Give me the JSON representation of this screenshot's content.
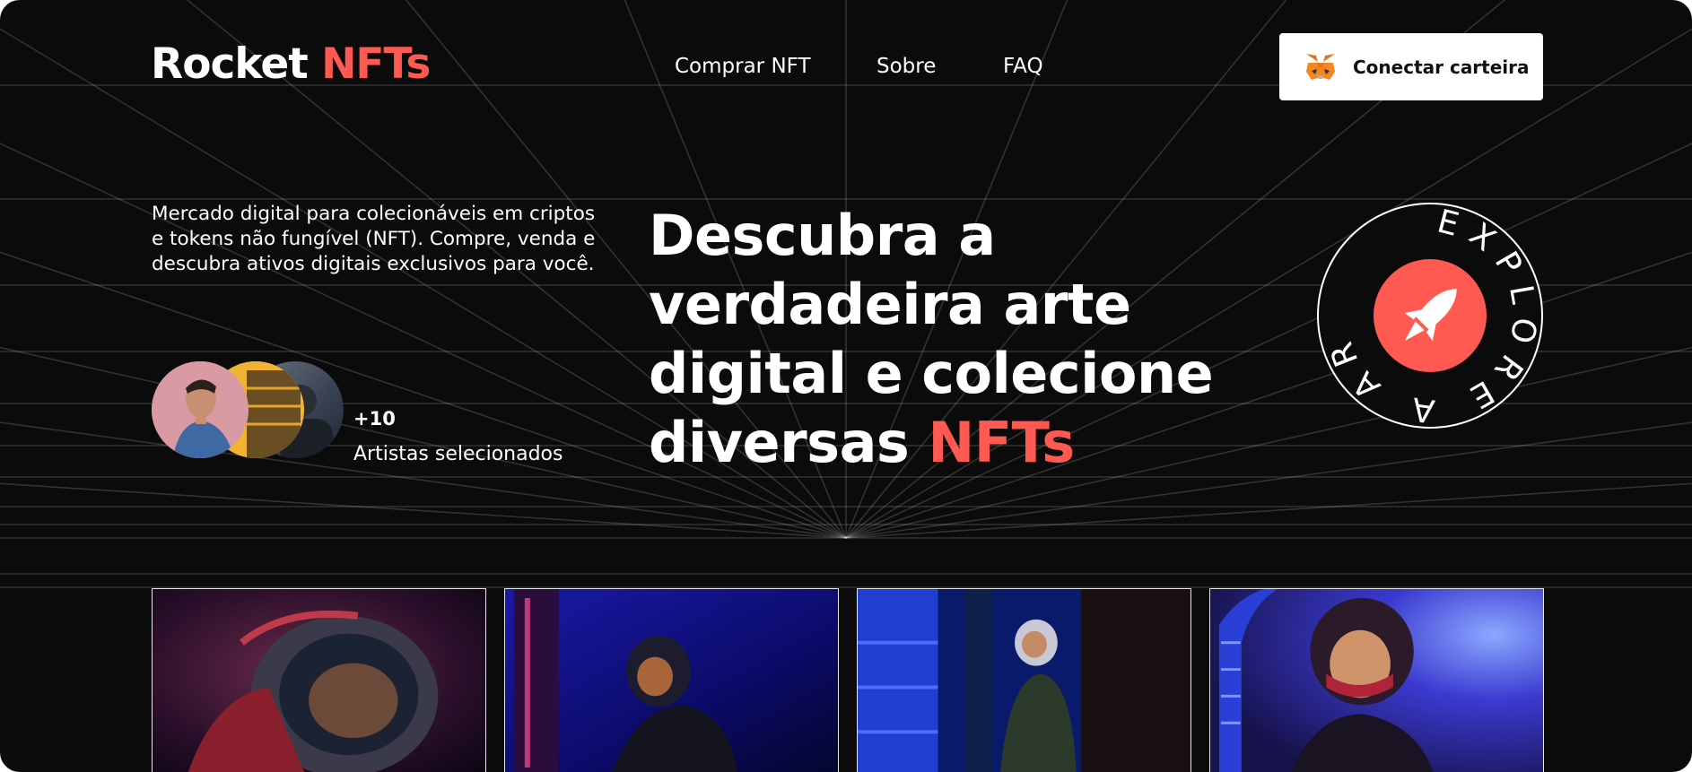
{
  "brand": {
    "name_main": "Rocket",
    "name_accent": "NFTs"
  },
  "nav": [
    {
      "label": "Comprar NFT"
    },
    {
      "label": "Sobre"
    },
    {
      "label": "FAQ"
    }
  ],
  "wallet": {
    "label": "Conectar carteira",
    "icon": "metamask-fox-icon"
  },
  "hero": {
    "description": "Mercado digital para colecionáveis em criptos e tokens não fungível (NFT). Compre, venda e descubra ativos digitais exclusivos para você.",
    "artists_count": "+10",
    "artists_label": "Artistas selecionados",
    "headline_line1": "Descubra a",
    "headline_line2": "verdadeira arte",
    "headline_line3": "digital e colecione",
    "headline_line4_prefix": "diversas",
    "headline_accent": "NFTs"
  },
  "badge": {
    "text": "EXPLORE A ARTE",
    "icon": "rocket-icon"
  },
  "gallery": [
    {
      "name": "nft-card-1",
      "subject": "astronaut-helmet-red"
    },
    {
      "name": "nft-card-2",
      "subject": "astronaut-corridor-blue"
    },
    {
      "name": "nft-card-3",
      "subject": "astronaut-station-blue"
    },
    {
      "name": "nft-card-4",
      "subject": "astronaut-portrait-purple"
    }
  ],
  "colors": {
    "background": "#0b0b0b",
    "accent": "#ff5a52",
    "text": "#ffffff"
  }
}
